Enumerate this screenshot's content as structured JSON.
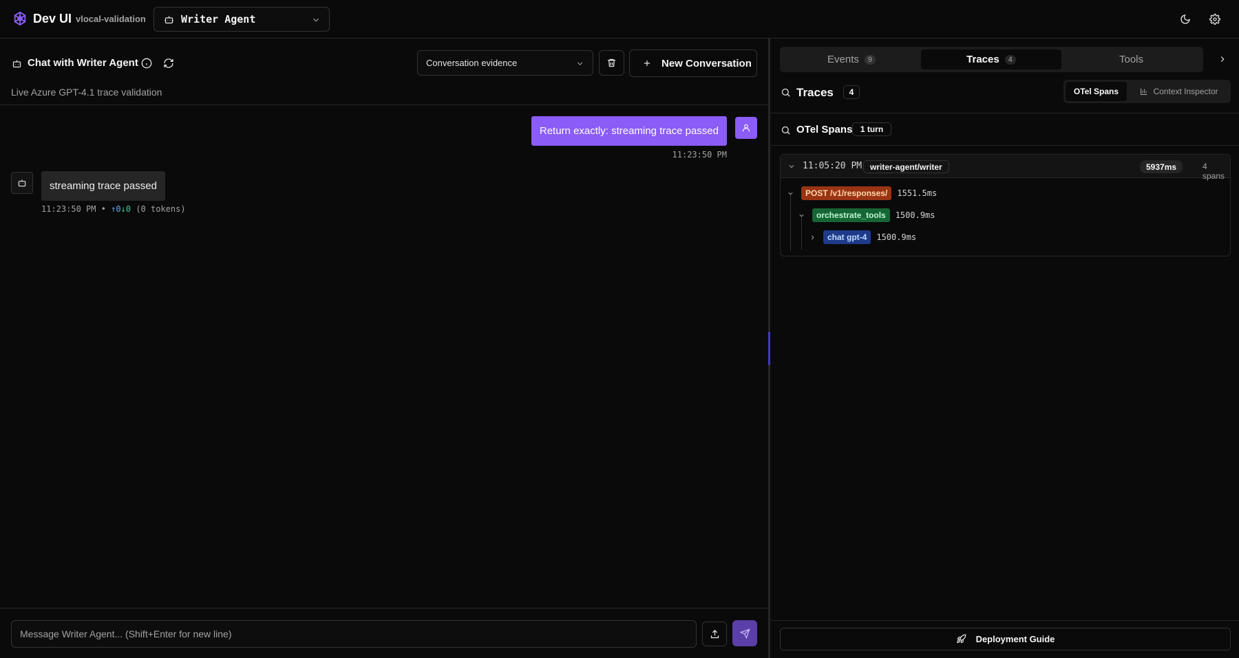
{
  "header": {
    "brand": "Dev UI",
    "workspace": "vlocal-validation",
    "agent_selected": "Writer Agent"
  },
  "chat": {
    "title": "Chat with Writer Agent",
    "subtitle": "Live Azure GPT-4.1 trace validation",
    "conversation_select": "Conversation evidence",
    "new_conversation_label": "New Conversation",
    "messages": [
      {
        "role": "user",
        "text": "Return exactly: streaming trace passed",
        "time": "11:23:50 PM"
      },
      {
        "role": "assistant",
        "text": "streaming trace passed",
        "time": "11:23:50 PM",
        "sep": "•",
        "up": "↑0",
        "down": "↓0",
        "tokens": "(0 tokens)"
      }
    ],
    "composer_placeholder": "Message Writer Agent... (Shift+Enter for new line)"
  },
  "panel": {
    "tabs": [
      {
        "label": "Events",
        "count": "9"
      },
      {
        "label": "Traces",
        "count": "4",
        "active": true
      },
      {
        "label": "Tools"
      }
    ],
    "traces_title": "Traces",
    "traces_count": "4",
    "view_toggle": {
      "otel": "OTel Spans",
      "context": "Context Inspector"
    },
    "otel_title": "OTel Spans",
    "turn_badge": "1 turn",
    "trace": {
      "time": "11:05:20 PM",
      "name": "writer-agent/writer",
      "duration": "5937ms",
      "spans": "4 spans",
      "span_rows": [
        {
          "name": "POST /v1/responses/",
          "duration": "1551.5ms",
          "color": "#9a3412",
          "text_color": "#fed7aa"
        },
        {
          "name": "orchestrate_tools",
          "duration": "1500.9ms",
          "color": "#166534",
          "text_color": "#bbf7d0"
        },
        {
          "name": "chat gpt-4",
          "duration": "1500.9ms",
          "color": "#1e3a8a",
          "text_color": "#bfdbfe"
        }
      ]
    },
    "deploy_label": "Deployment Guide"
  },
  "colors": {
    "accent": "#8b5cf6",
    "background": "#0a0a0a",
    "border": "#262626"
  }
}
